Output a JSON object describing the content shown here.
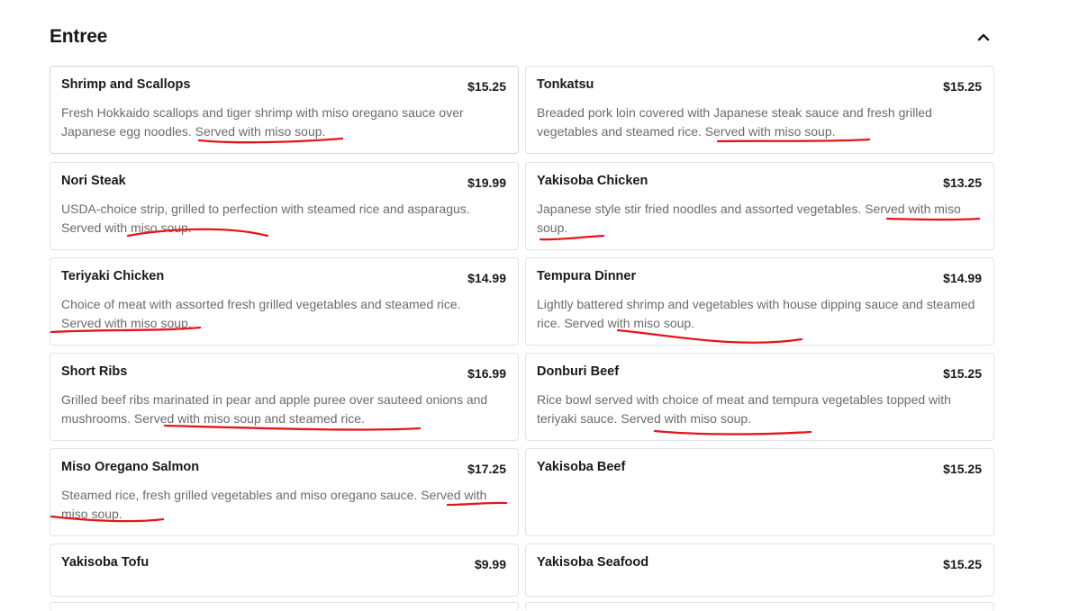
{
  "section": {
    "title": "Entree",
    "collapse_icon": "chevron-up-icon"
  },
  "items": [
    {
      "name": "Shrimp and Scallops",
      "price": "$15.25",
      "desc": "Fresh Hokkaido scallops and tiger shrimp with miso oregano sauce over Japanese egg noodles. Served with miso soup."
    },
    {
      "name": "Tonkatsu",
      "price": "$15.25",
      "desc": "Breaded pork loin covered with Japanese steak sauce and fresh grilled vegetables and steamed rice. Served with miso soup."
    },
    {
      "name": "Nori Steak",
      "price": "$19.99",
      "desc": "USDA-choice strip, grilled to perfection with steamed rice and asparagus. Served with miso soup."
    },
    {
      "name": "Yakisoba Chicken",
      "price": "$13.25",
      "desc": "Japanese style stir fried noodles and assorted vegetables. Served with miso soup."
    },
    {
      "name": "Teriyaki Chicken",
      "price": "$14.99",
      "desc": "Choice of meat with assorted fresh grilled vegetables and steamed rice. Served with miso soup."
    },
    {
      "name": "Tempura Dinner",
      "price": "$14.99",
      "desc": "Lightly battered shrimp and vegetables with house dipping sauce and steamed rice. Served with miso soup."
    },
    {
      "name": "Short Ribs",
      "price": "$16.99",
      "desc": "Grilled beef ribs marinated in pear and apple puree over sauteed onions and mushrooms. Served with miso soup and steamed rice."
    },
    {
      "name": "Donburi Beef",
      "price": "$15.25",
      "desc": "Rice bowl served with choice of meat and tempura vegetables topped with teriyaki sauce. Served with miso soup."
    },
    {
      "name": "Miso Oregano Salmon",
      "price": "$17.25",
      "desc": "Steamed rice, fresh grilled vegetables and miso oregano sauce. Served with miso soup."
    },
    {
      "name": "Yakisoba Beef",
      "price": "$15.25",
      "desc": ""
    },
    {
      "name": "Yakisoba Tofu",
      "price": "$9.99",
      "desc": ""
    },
    {
      "name": "Yakisoba Seafood",
      "price": "$15.25",
      "desc": ""
    }
  ],
  "colors": {
    "annotation": "#e8141c",
    "text_primary": "#191919",
    "text_secondary": "#6b6b6b",
    "card_border": "#e2e2e2"
  }
}
